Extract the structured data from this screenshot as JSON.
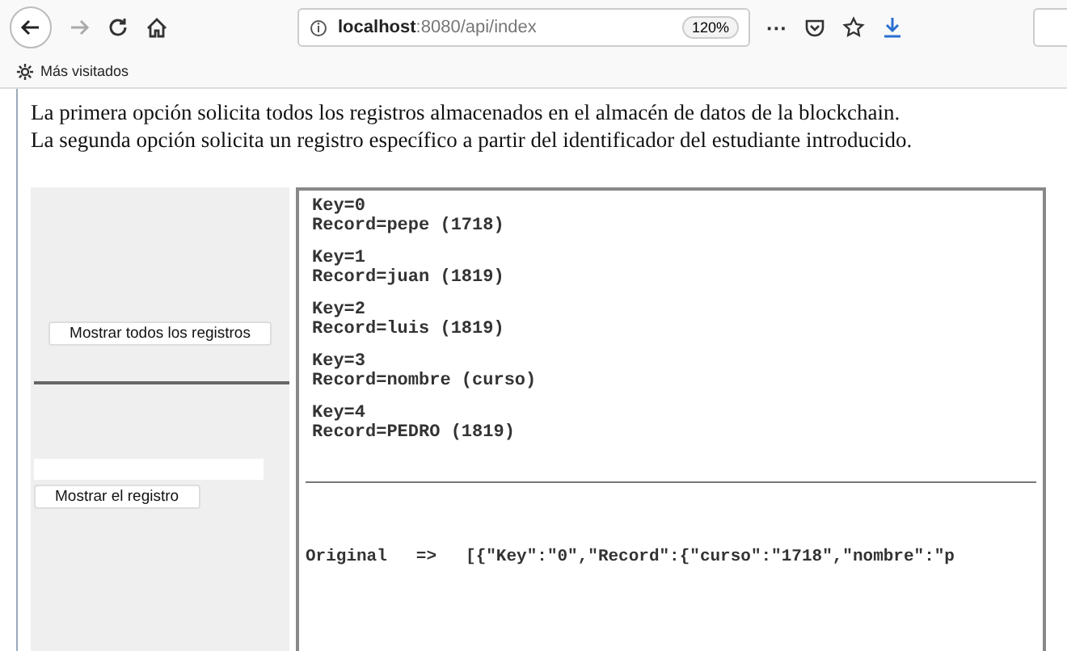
{
  "toolbar": {
    "back_disabled": false,
    "forward_disabled": true,
    "url_host": "localhost",
    "url_path": ":8080/api/index",
    "zoom": "120%",
    "more": "···"
  },
  "bookmarks": [
    {
      "label": "Más visitados"
    }
  ],
  "intro": [
    "La primera opción solicita todos los registros almacenados en el almacén de datos de la blockchain.",
    "La segunda opción solicita un registro específico a partir del identificador del estudiante introducido."
  ],
  "sidebar": {
    "show_all_button": "Mostrar todos los registros",
    "show_one_button": "Mostrar el registro"
  },
  "output": {
    "records": [
      {
        "key": "Key=0",
        "record": "Record=pepe (1718)"
      },
      {
        "key": "Key=1",
        "record": "Record=juan (1819)"
      },
      {
        "key": "Key=2",
        "record": "Record=luis (1819)"
      },
      {
        "key": "Key=3",
        "record": "Record=nombre (curso)"
      },
      {
        "key": "Key=4",
        "record": "Record=PEDRO (1819)"
      }
    ],
    "original_label": "Original",
    "arrow": "=>",
    "original_json": "[{\"Key\":\"0\",\"Record\":{\"curso\":\"1718\",\"nombre\":\"p"
  }
}
